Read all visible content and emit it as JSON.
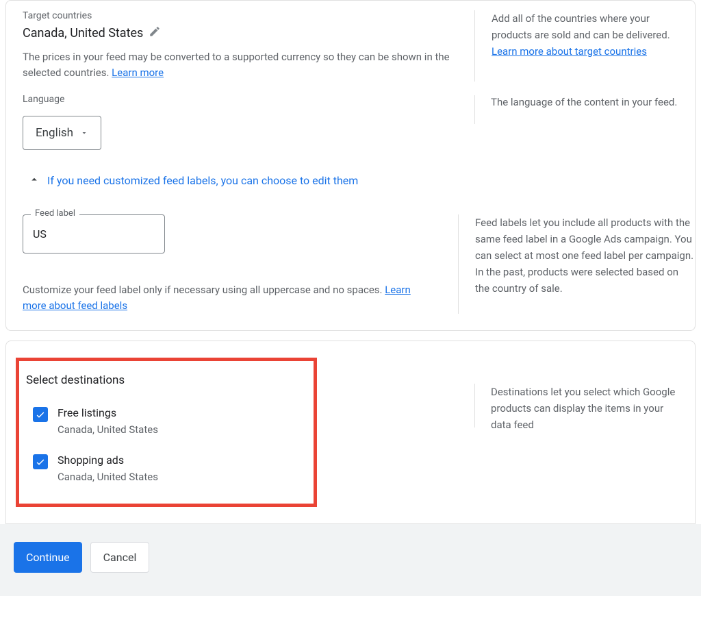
{
  "targetCountries": {
    "label": "Target countries",
    "value": "Canada, United States",
    "helpText": "The prices in your feed may be converted to a supported currency so they can be shown in the selected countries. ",
    "helpLink": "Learn more",
    "aside": "Add all of the countries where your products are sold and can be delivered.",
    "asideLink": "Learn more about target countries"
  },
  "language": {
    "label": "Language",
    "value": "English",
    "aside": "The language of the content in your feed."
  },
  "expand": {
    "text": "If you need customized feed labels, you can choose to edit them"
  },
  "feedLabel": {
    "label": "Feed label",
    "value": "US",
    "helpText": "Customize your feed label only if necessary using all uppercase and no spaces. ",
    "helpLink": "Learn more about feed labels",
    "aside": "Feed labels let you include all products with the same feed label in a Google Ads campaign. You can select at most one feed label per campaign. In the past, products were selected based on the country of sale."
  },
  "destinations": {
    "title": "Select destinations",
    "items": [
      {
        "name": "Free listings",
        "sub": "Canada, United States",
        "checked": true
      },
      {
        "name": "Shopping ads",
        "sub": "Canada, United States",
        "checked": true
      }
    ],
    "aside": "Destinations let you select which Google products can display the items in your data feed"
  },
  "buttons": {
    "continue": "Continue",
    "cancel": "Cancel"
  }
}
